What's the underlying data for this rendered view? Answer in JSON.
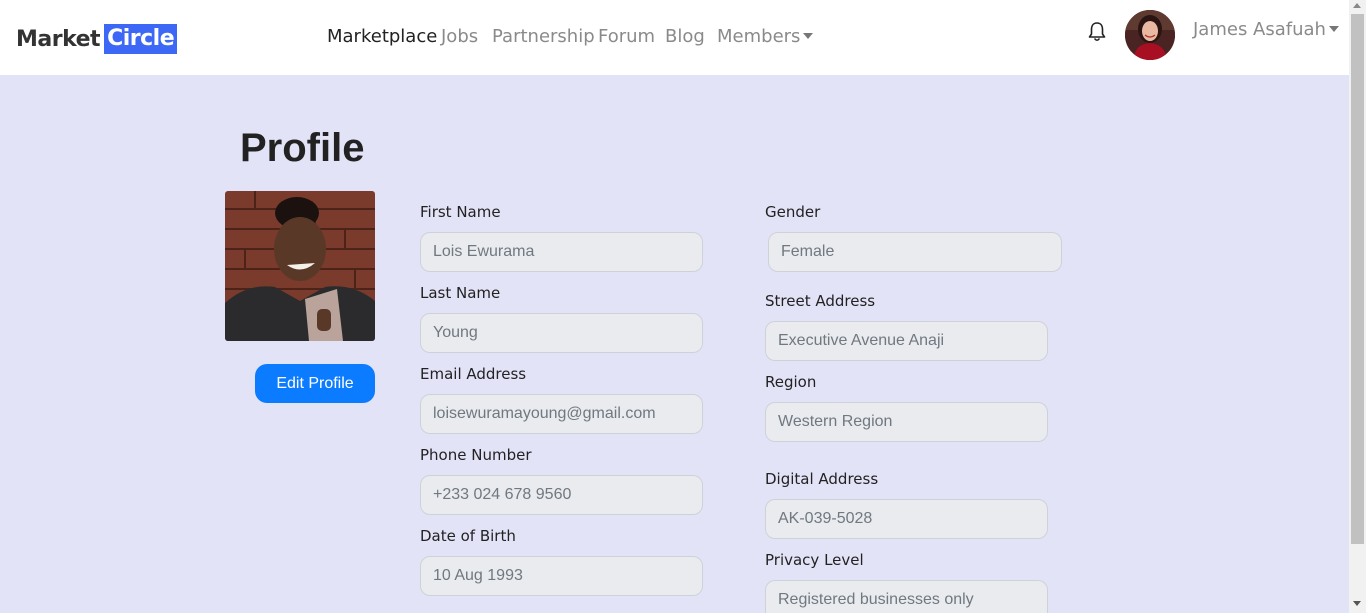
{
  "brand": {
    "part1": "Market",
    "part2": "Circle"
  },
  "nav": {
    "items": [
      {
        "label": "Marketplace"
      },
      {
        "label": "Jobs"
      },
      {
        "label": "Partnership"
      },
      {
        "label": "Forum"
      },
      {
        "label": "Blog"
      },
      {
        "label": "Members"
      }
    ],
    "user_name": "James Asafuah",
    "icons": {
      "notifications": "bell-icon",
      "dropdown": "caret-down-icon"
    }
  },
  "page": {
    "title": "Profile"
  },
  "profile": {
    "edit_label": "Edit Profile"
  },
  "form": {
    "first_name": {
      "label": "First Name",
      "value": "Lois Ewurama"
    },
    "last_name": {
      "label": "Last Name",
      "value": "Young"
    },
    "email": {
      "label": "Email Address",
      "value": "loisewuramayoung@gmail.com"
    },
    "phone": {
      "label": "Phone Number",
      "value": "+233 024 678 9560"
    },
    "dob": {
      "label": "Date of Birth",
      "value": "10 Aug 1993"
    },
    "gender": {
      "label": "Gender",
      "value": "Female"
    },
    "street": {
      "label": "Street Address",
      "value": "Executive Avenue Anaji"
    },
    "region": {
      "label": "Region",
      "value": "Western Region"
    },
    "digital_address": {
      "label": "Digital Address",
      "value": "AK-039-5028"
    },
    "privacy": {
      "label": "Privacy Level",
      "value": "Registered businesses only"
    }
  },
  "colors": {
    "accent": "#0b7bff",
    "brand_blue": "#3d68f5",
    "background": "#e3e3f8"
  }
}
